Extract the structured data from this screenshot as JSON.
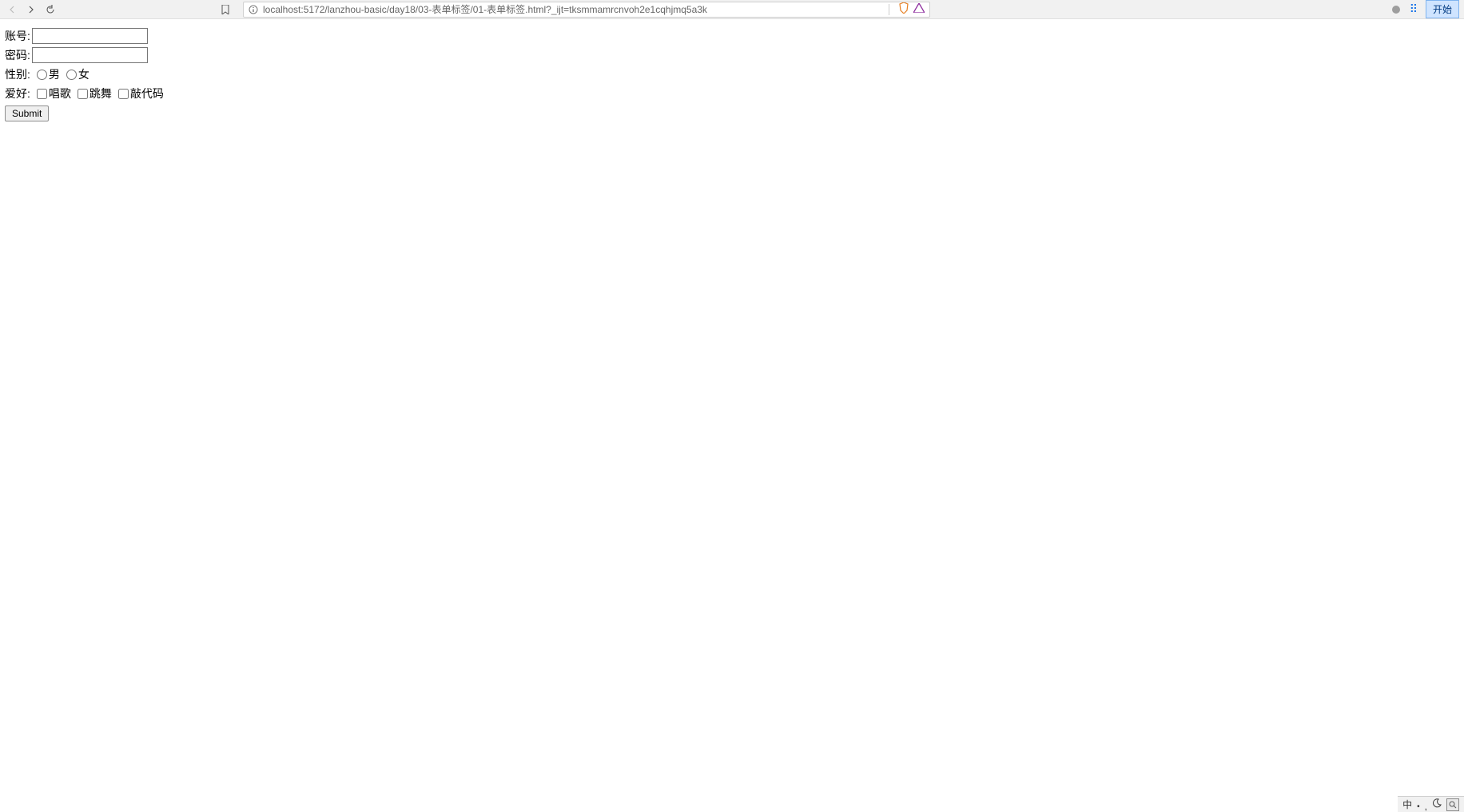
{
  "browser": {
    "url": "localhost:5172/lanzhou-basic/day18/03-表单标签/01-表单标签.html?_ijt=tksmmamrcnvoh2e1cqhjmq5a3k",
    "start_button": "开始"
  },
  "form": {
    "account_label": "账号: ",
    "password_label": "密码: ",
    "gender_label": "性别: ",
    "gender_options": {
      "male": "男",
      "female": "女"
    },
    "hobby_label": "爱好: ",
    "hobby_options": {
      "sing": "唱歌",
      "dance": "跳舞",
      "code": "敲代码"
    },
    "submit_label": "Submit"
  },
  "taskbar": {
    "ime": "中"
  }
}
